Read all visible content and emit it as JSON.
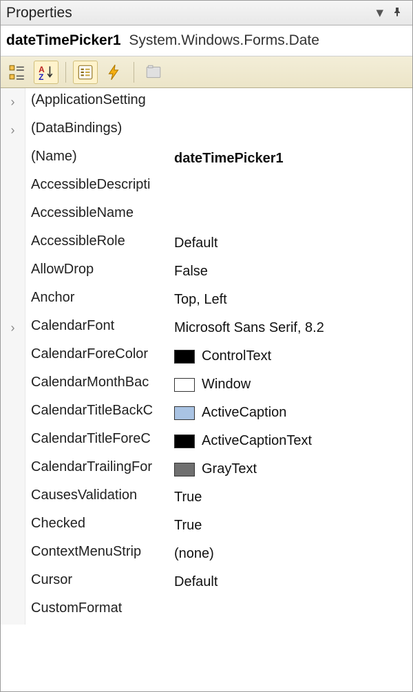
{
  "title": "Properties",
  "object": {
    "name": "dateTimePicker1",
    "type": "System.Windows.Forms.Date"
  },
  "swatches": {
    "ControlText": "#000000",
    "Window": "#ffffff",
    "ActiveCaption": "#a9c3e3",
    "ActiveCaptionText": "#000000",
    "GrayText": "#6f6f6f"
  },
  "rows": [
    {
      "name": "(ApplicationSetting",
      "value": "",
      "expand": true
    },
    {
      "name": "(DataBindings)",
      "value": "",
      "expand": true
    },
    {
      "name": "(Name)",
      "value": "dateTimePicker1",
      "bold": true
    },
    {
      "name": "AccessibleDescripti",
      "value": ""
    },
    {
      "name": "AccessibleName",
      "value": ""
    },
    {
      "name": "AccessibleRole",
      "value": "Default"
    },
    {
      "name": "AllowDrop",
      "value": "False"
    },
    {
      "name": "Anchor",
      "value": "Top, Left"
    },
    {
      "name": "CalendarFont",
      "value": "Microsoft Sans Serif, 8.2",
      "expand": true
    },
    {
      "name": "CalendarForeColor",
      "value": "ControlText",
      "swatchKey": "ControlText"
    },
    {
      "name": "CalendarMonthBac",
      "value": "Window",
      "swatchKey": "Window"
    },
    {
      "name": "CalendarTitleBackC",
      "value": "ActiveCaption",
      "swatchKey": "ActiveCaption"
    },
    {
      "name": "CalendarTitleForeC",
      "value": "ActiveCaptionText",
      "swatchKey": "ActiveCaptionText"
    },
    {
      "name": "CalendarTrailingFor",
      "value": "GrayText",
      "swatchKey": "GrayText"
    },
    {
      "name": "CausesValidation",
      "value": "True"
    },
    {
      "name": "Checked",
      "value": "True"
    },
    {
      "name": "ContextMenuStrip",
      "value": "(none)"
    },
    {
      "name": "Cursor",
      "value": "Default"
    },
    {
      "name": "CustomFormat",
      "value": ""
    }
  ]
}
